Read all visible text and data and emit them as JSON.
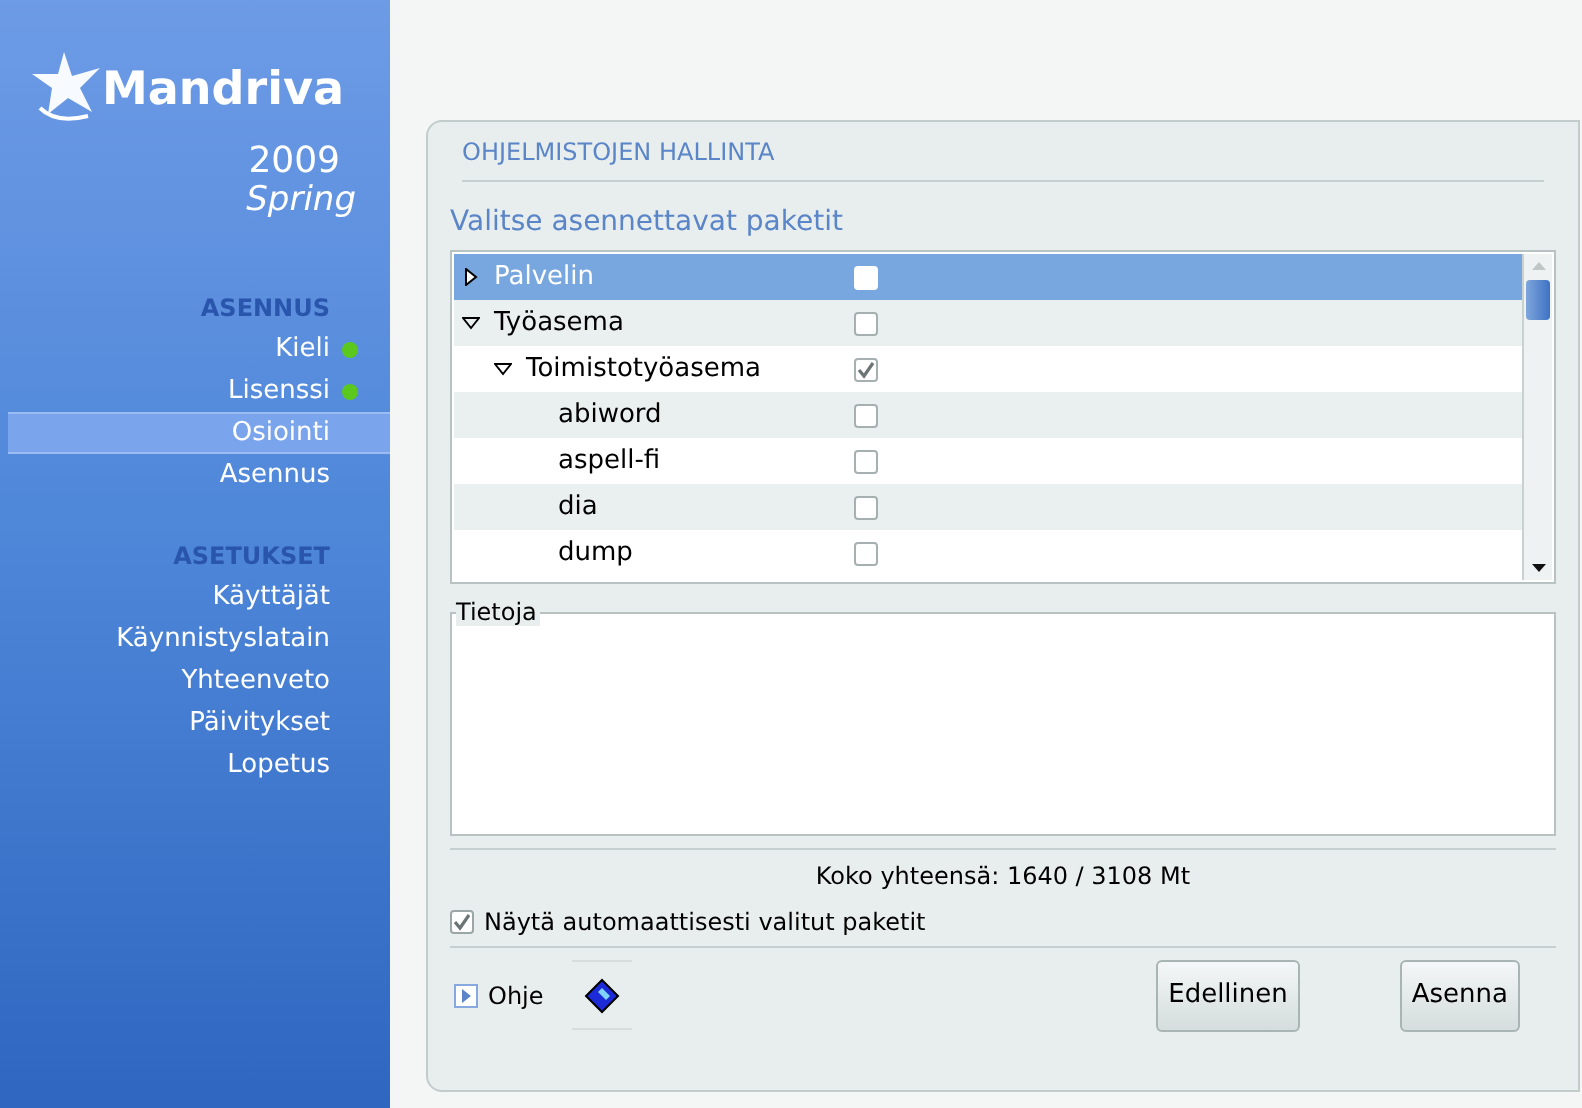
{
  "logo": {
    "brand": "Mandriva",
    "year": "2009",
    "edition": "Spring"
  },
  "sidebar": [
    {
      "heading": "ASENNUS",
      "items": [
        {
          "label": "Kieli",
          "done": true,
          "selected": false
        },
        {
          "label": "Lisenssi",
          "done": true,
          "selected": false
        },
        {
          "label": "Osiointi",
          "done": false,
          "selected": true
        },
        {
          "label": "Asennus",
          "done": false,
          "selected": false
        }
      ]
    },
    {
      "heading": "ASETUKSET",
      "items": [
        {
          "label": "Käyttäjät",
          "done": false,
          "selected": false
        },
        {
          "label": "Käynnistyslatain",
          "done": false,
          "selected": false
        },
        {
          "label": "Yhteenveto",
          "done": false,
          "selected": false
        },
        {
          "label": "Päivitykset",
          "done": false,
          "selected": false
        },
        {
          "label": "Lopetus",
          "done": false,
          "selected": false
        }
      ]
    }
  ],
  "panel_title": "OHJELMISTOJEN HALLINTA",
  "subtitle": "Valitse asennettavat paketit",
  "tree": [
    {
      "label": "Palvelin",
      "expanded": false,
      "checked": false,
      "selected": true
    },
    {
      "label": "Työasema",
      "expanded": true,
      "checked": false,
      "selected": false,
      "children": [
        {
          "label": "Toimistotyöasema",
          "expanded": true,
          "checked": true,
          "selected": false,
          "children": [
            {
              "label": "abiword",
              "checked": false,
              "selected": false
            },
            {
              "label": "aspell-fi",
              "checked": false,
              "selected": false
            },
            {
              "label": "dia",
              "checked": false,
              "selected": false
            },
            {
              "label": "dump",
              "checked": false,
              "selected": false
            }
          ]
        }
      ]
    }
  ],
  "info_label": "Tietoja",
  "total": "Koko yhteensä: 1640 / 3108 Mt",
  "show_auto": {
    "label": "Näytä automaattisesti valitut paketit",
    "checked": true
  },
  "help": "Ohje",
  "buttons": [
    "Edellinen",
    "Asenna"
  ]
}
